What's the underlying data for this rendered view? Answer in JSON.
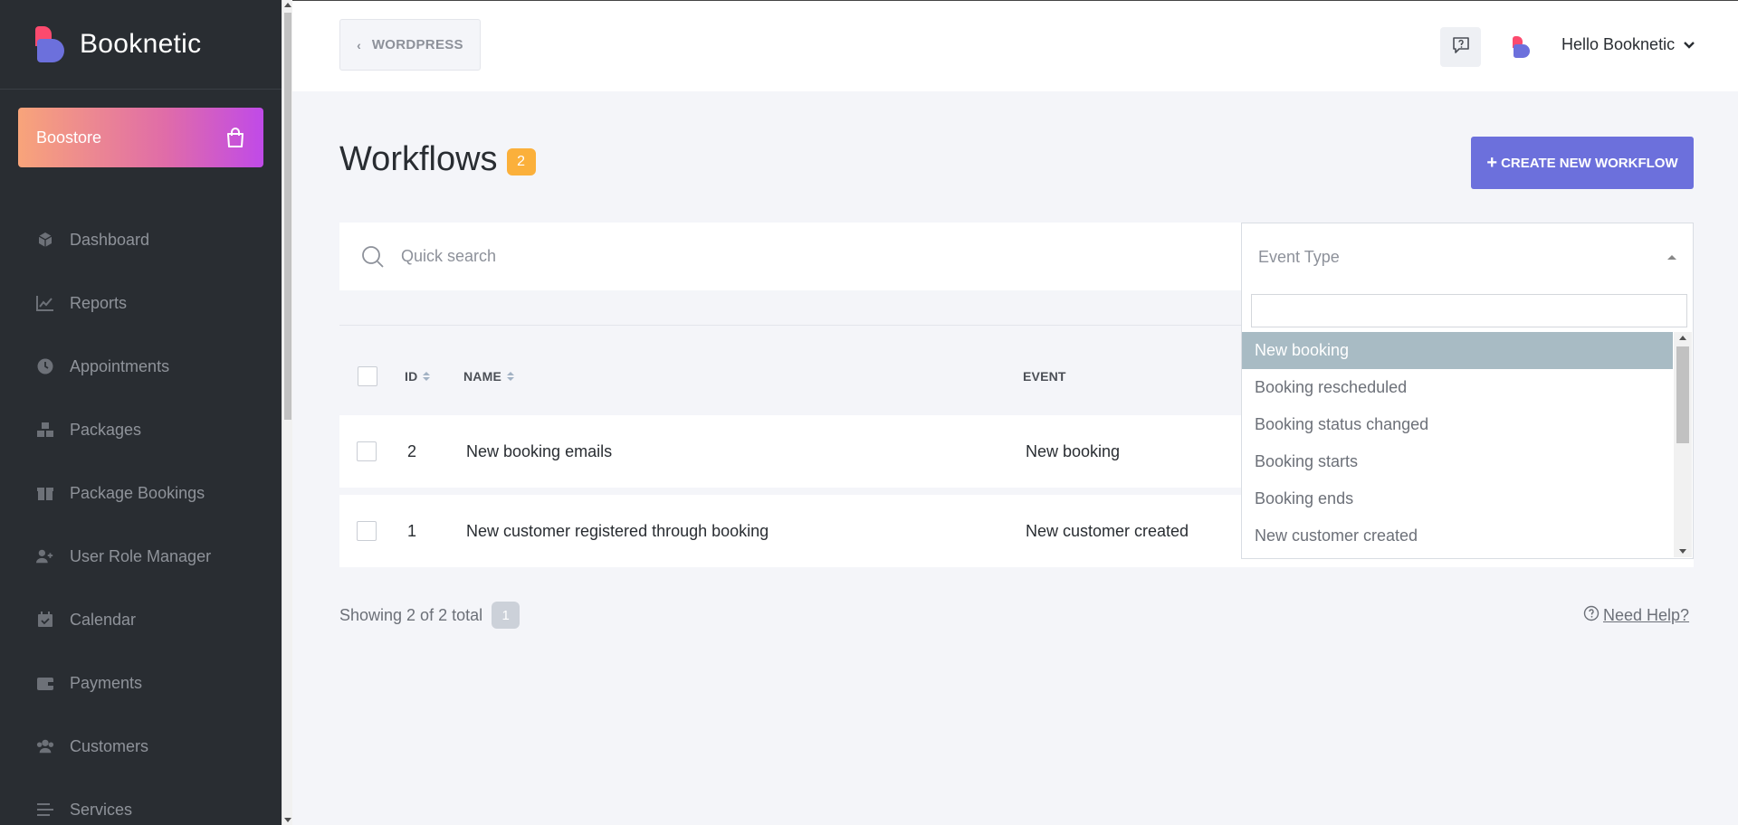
{
  "app": {
    "name": "Booknetic"
  },
  "sidebar": {
    "boostore_label": "Boostore",
    "items": [
      {
        "label": "Dashboard",
        "icon": "cube-icon"
      },
      {
        "label": "Reports",
        "icon": "chart-line-icon"
      },
      {
        "label": "Appointments",
        "icon": "clock-icon"
      },
      {
        "label": "Packages",
        "icon": "boxes-icon"
      },
      {
        "label": "Package Bookings",
        "icon": "gift-box-icon"
      },
      {
        "label": "User Role Manager",
        "icon": "user-plus-icon"
      },
      {
        "label": "Calendar",
        "icon": "calendar-check-icon"
      },
      {
        "label": "Payments",
        "icon": "wallet-icon"
      },
      {
        "label": "Customers",
        "icon": "users-icon"
      },
      {
        "label": "Services",
        "icon": "list-icon"
      }
    ]
  },
  "header": {
    "back_label": "WORDPRESS",
    "user_greeting": "Hello Booknetic"
  },
  "page": {
    "title": "Workflows",
    "count": "2",
    "create_button": "CREATE NEW WORKFLOW"
  },
  "filters": {
    "search_placeholder": "Quick search",
    "event_type_label": "Event Type"
  },
  "table": {
    "columns": {
      "id": "ID",
      "name": "NAME",
      "event": "EVENT"
    },
    "rows": [
      {
        "id": "2",
        "name": "New booking emails",
        "event": "New booking"
      },
      {
        "id": "1",
        "name": "New customer registered through booking",
        "event": "New customer created"
      }
    ]
  },
  "footer": {
    "showing": "Showing 2 of 2 total",
    "page": "1",
    "need_help": "Need Help?"
  },
  "dropdown": {
    "search_value": "",
    "options": [
      "New booking",
      "Booking rescheduled",
      "Booking status changed",
      "Booking starts",
      "Booking ends",
      "New customer created"
    ],
    "active_index": 0
  },
  "colors": {
    "sidebar_bg": "#292d32",
    "accent": "#6c70dc",
    "brand_red": "#fc4a6e",
    "badge": "#fbb03b",
    "dropdown_active": "#a8bbc4"
  }
}
